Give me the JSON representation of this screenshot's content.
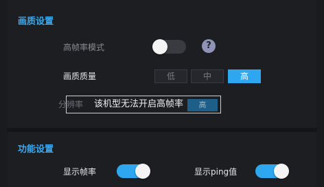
{
  "graphics": {
    "title": "画质设置",
    "high_fps_label": "高帧率模式",
    "help_glyph": "?",
    "quality_label": "画质质量",
    "quality_options": [
      "低",
      "中",
      "高"
    ],
    "quality_selected": "高",
    "resolution_label": "分辨率",
    "resolution_value": "高",
    "tooltip_text": "该机型无法开启高帧率",
    "high_fps_enabled": false
  },
  "features": {
    "title": "功能设置",
    "show_fps_label": "显示帧率",
    "show_fps_enabled": true,
    "show_ping_label": "显示ping值",
    "show_ping_enabled": true
  },
  "colors": {
    "accent": "#2ea7f0",
    "title": "#3aa9ee",
    "background": "#1d1e22"
  }
}
